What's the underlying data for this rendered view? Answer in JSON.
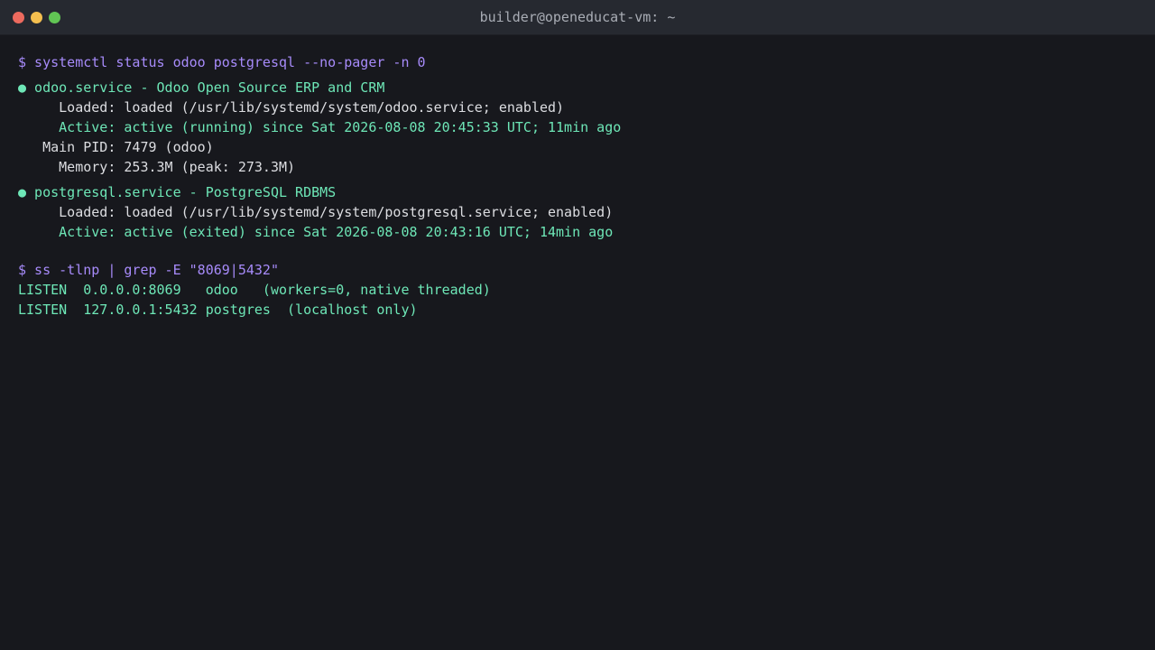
{
  "window": {
    "title": "builder@openeducat-vm: ~"
  },
  "colors": {
    "command": "#a78bfa",
    "ok": "#6ee7b7",
    "text": "#dcdde1",
    "background": "#17181d"
  },
  "terminal": {
    "cmd1": "$ systemctl status odoo postgresql --no-pager -n 0",
    "odoo": {
      "header": "● odoo.service - Odoo Open Source ERP and CRM",
      "loaded": "     Loaded: loaded (/usr/lib/systemd/system/odoo.service; enabled)",
      "active": "     Active: active (running) since Sat 2026-08-08 20:45:33 UTC; 11min ago",
      "pid": "   Main PID: 7479 (odoo)",
      "memory": "     Memory: 253.3M (peak: 273.3M)"
    },
    "postgres": {
      "header": "● postgresql.service - PostgreSQL RDBMS",
      "loaded": "     Loaded: loaded (/usr/lib/systemd/system/postgresql.service; enabled)",
      "active": "     Active: active (exited) since Sat 2026-08-08 20:43:16 UTC; 14min ago"
    },
    "cmd2": "$ ss -tlnp | grep -E \"8069|5432\"",
    "listen1": "LISTEN  0.0.0.0:8069   odoo   (workers=0, native threaded)",
    "listen2": "LISTEN  127.0.0.1:5432 postgres  (localhost only)"
  }
}
